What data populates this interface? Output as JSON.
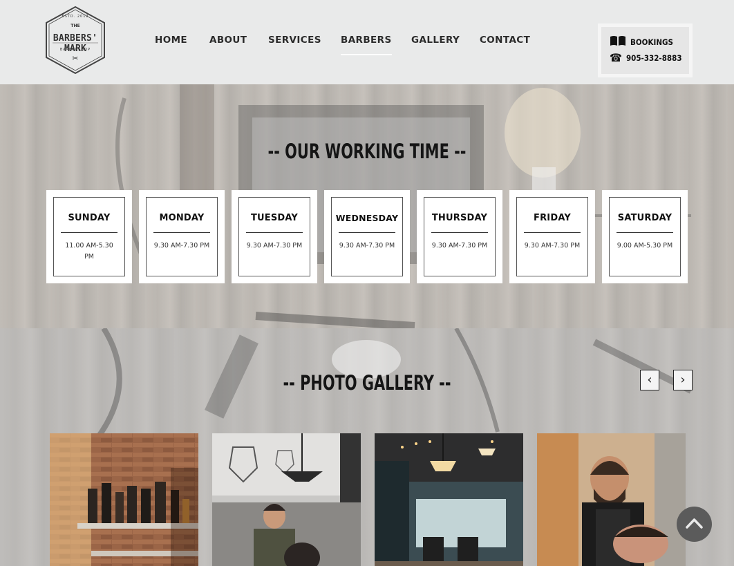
{
  "logo": {
    "estd": "ESTD. 2012",
    "the": "THE",
    "name": "BARBERS' MARK",
    "sub": "BARBERSHOP",
    "scissors": "✂"
  },
  "nav": {
    "items": [
      {
        "label": "HOME",
        "active": false
      },
      {
        "label": "ABOUT",
        "active": false
      },
      {
        "label": "SERVICES",
        "active": false
      },
      {
        "label": "BARBERS",
        "active": true
      },
      {
        "label": "GALLERY",
        "active": false
      },
      {
        "label": "CONTACT",
        "active": false
      }
    ]
  },
  "booking": {
    "bookings_label": "BOOKINGS",
    "phone": "905-332-8883",
    "book_icon": "book-icon",
    "phone_icon": "phone-icon"
  },
  "working": {
    "title": "-- OUR WORKING TIME --",
    "days": [
      {
        "name": "SUNDAY",
        "hours": "11.00 AM-5.30 PM"
      },
      {
        "name": "MONDAY",
        "hours": "9.30 AM-7.30 PM"
      },
      {
        "name": "TUESDAY",
        "hours": "9.30 AM-7.30 PM"
      },
      {
        "name": "WEDNESDAY",
        "hours": "9.30 AM-7.30 PM"
      },
      {
        "name": "THURSDAY",
        "hours": "9.30 AM-7.30 PM"
      },
      {
        "name": "FRIDAY",
        "hours": "9.30 AM-7.30 PM"
      },
      {
        "name": "SATURDAY",
        "hours": "9.00 AM-5.30 PM"
      }
    ]
  },
  "gallery": {
    "title": "-- PHOTO GALLERY --",
    "prev_icon": "chevron-left-icon",
    "next_icon": "chevron-right-icon",
    "prev_glyph": "‹",
    "next_glyph": "›"
  },
  "scroll_top": {
    "icon": "chevron-up-icon",
    "glyph": "⌃"
  },
  "colors": {
    "header_bg": "#e9eaea",
    "text_dark": "#151515",
    "card_bg": "#ffffff",
    "scroll_btn": "#5b5b5b"
  }
}
